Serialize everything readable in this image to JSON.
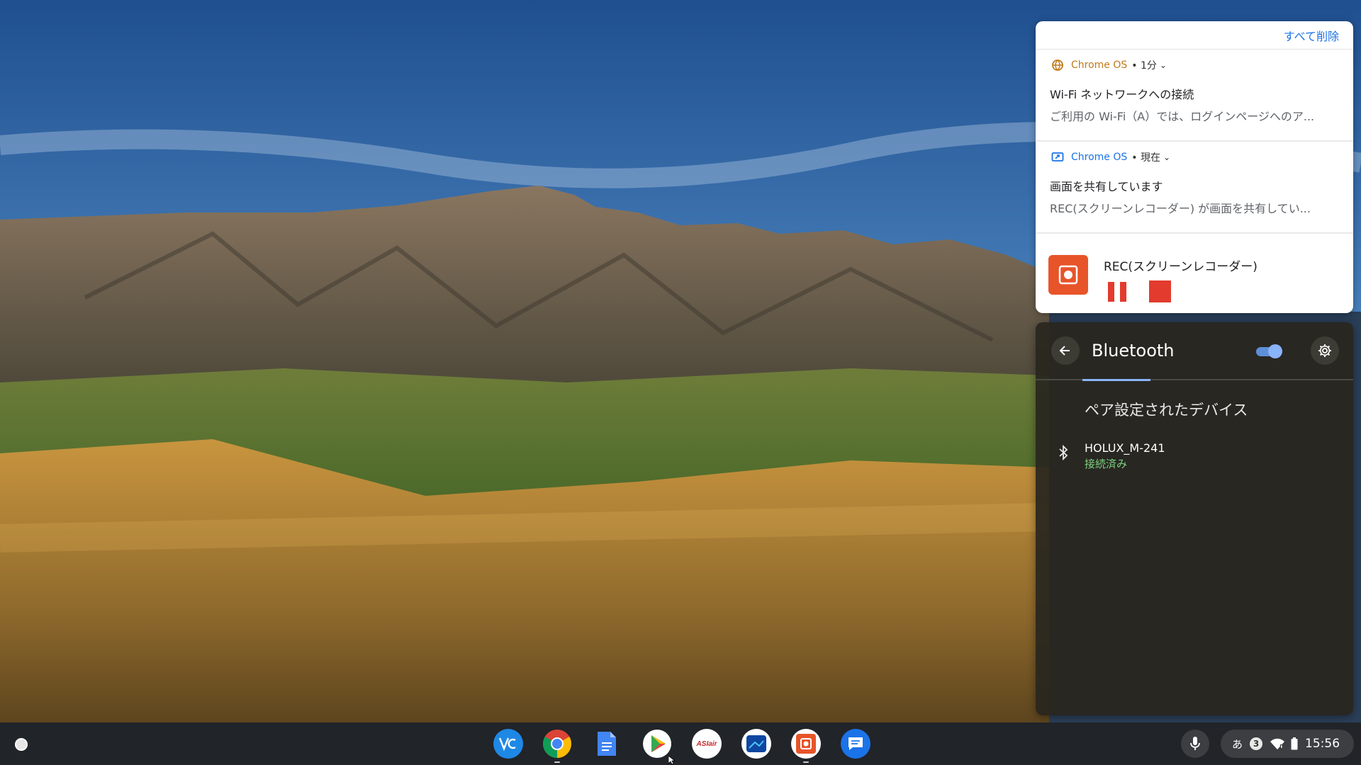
{
  "notifications": {
    "clear_all": "すべて削除",
    "items": [
      {
        "source": "Chrome OS",
        "meta": "• 1分",
        "icon": "globe-icon",
        "title": "Wi-Fi ネットワークへの接続",
        "body": "ご利用の Wi-Fi（A）では、ログインページへのア..."
      },
      {
        "source": "Chrome OS",
        "meta": "• 現在",
        "icon": "screen-share-icon",
        "title": "画面を共有しています",
        "body": "REC(スクリーンレコーダー) が画面を共有してい..."
      }
    ],
    "recorder": {
      "title": "REC(スクリーンレコーダー)",
      "icon": "screen-recorder-icon",
      "pause_icon": "pause-icon",
      "stop_icon": "stop-icon"
    }
  },
  "bluetooth": {
    "title": "Bluetooth",
    "enabled": true,
    "section_title": "ペア設定されたデバイス",
    "devices": [
      {
        "name": "HOLUX_M-241",
        "status": "接続済み",
        "icon": "bluetooth-icon"
      }
    ]
  },
  "shelf": {
    "apps": [
      {
        "name": "vectr-app-icon",
        "color": "#1e88e5"
      },
      {
        "name": "chrome-app-icon",
        "color": "#db4437"
      },
      {
        "name": "docs-app-icon",
        "color": "#4285f4"
      },
      {
        "name": "play-store-app-icon",
        "color": "#34a853"
      },
      {
        "name": "asiair-app-icon",
        "label": "ASIair",
        "color": "#c62828"
      },
      {
        "name": "photo-app-icon",
        "color": "#0d47a1"
      },
      {
        "name": "screen-recorder-app-icon",
        "color": "#e8542a"
      },
      {
        "name": "messages-app-icon",
        "color": "#1a73e8"
      }
    ],
    "status": {
      "ime": "あ",
      "notification_count": "3",
      "time": "15:56"
    }
  },
  "colors": {
    "accent": "#1a73e8",
    "notif_source": "#c0791a",
    "recorder": "#e33b2e",
    "connected": "#7dd17f",
    "toggle_on": "#8ab4f8"
  }
}
